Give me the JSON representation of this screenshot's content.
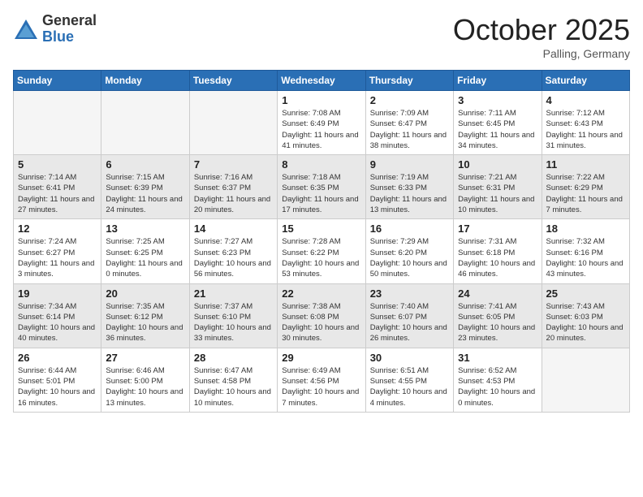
{
  "header": {
    "logo_general": "General",
    "logo_blue": "Blue",
    "month_title": "October 2025",
    "location": "Palling, Germany"
  },
  "weekdays": [
    "Sunday",
    "Monday",
    "Tuesday",
    "Wednesday",
    "Thursday",
    "Friday",
    "Saturday"
  ],
  "weeks": [
    {
      "shaded": false,
      "days": [
        {
          "num": "",
          "info": ""
        },
        {
          "num": "",
          "info": ""
        },
        {
          "num": "",
          "info": ""
        },
        {
          "num": "1",
          "info": "Sunrise: 7:08 AM\nSunset: 6:49 PM\nDaylight: 11 hours and 41 minutes."
        },
        {
          "num": "2",
          "info": "Sunrise: 7:09 AM\nSunset: 6:47 PM\nDaylight: 11 hours and 38 minutes."
        },
        {
          "num": "3",
          "info": "Sunrise: 7:11 AM\nSunset: 6:45 PM\nDaylight: 11 hours and 34 minutes."
        },
        {
          "num": "4",
          "info": "Sunrise: 7:12 AM\nSunset: 6:43 PM\nDaylight: 11 hours and 31 minutes."
        }
      ]
    },
    {
      "shaded": true,
      "days": [
        {
          "num": "5",
          "info": "Sunrise: 7:14 AM\nSunset: 6:41 PM\nDaylight: 11 hours and 27 minutes."
        },
        {
          "num": "6",
          "info": "Sunrise: 7:15 AM\nSunset: 6:39 PM\nDaylight: 11 hours and 24 minutes."
        },
        {
          "num": "7",
          "info": "Sunrise: 7:16 AM\nSunset: 6:37 PM\nDaylight: 11 hours and 20 minutes."
        },
        {
          "num": "8",
          "info": "Sunrise: 7:18 AM\nSunset: 6:35 PM\nDaylight: 11 hours and 17 minutes."
        },
        {
          "num": "9",
          "info": "Sunrise: 7:19 AM\nSunset: 6:33 PM\nDaylight: 11 hours and 13 minutes."
        },
        {
          "num": "10",
          "info": "Sunrise: 7:21 AM\nSunset: 6:31 PM\nDaylight: 11 hours and 10 minutes."
        },
        {
          "num": "11",
          "info": "Sunrise: 7:22 AM\nSunset: 6:29 PM\nDaylight: 11 hours and 7 minutes."
        }
      ]
    },
    {
      "shaded": false,
      "days": [
        {
          "num": "12",
          "info": "Sunrise: 7:24 AM\nSunset: 6:27 PM\nDaylight: 11 hours and 3 minutes."
        },
        {
          "num": "13",
          "info": "Sunrise: 7:25 AM\nSunset: 6:25 PM\nDaylight: 11 hours and 0 minutes."
        },
        {
          "num": "14",
          "info": "Sunrise: 7:27 AM\nSunset: 6:23 PM\nDaylight: 10 hours and 56 minutes."
        },
        {
          "num": "15",
          "info": "Sunrise: 7:28 AM\nSunset: 6:22 PM\nDaylight: 10 hours and 53 minutes."
        },
        {
          "num": "16",
          "info": "Sunrise: 7:29 AM\nSunset: 6:20 PM\nDaylight: 10 hours and 50 minutes."
        },
        {
          "num": "17",
          "info": "Sunrise: 7:31 AM\nSunset: 6:18 PM\nDaylight: 10 hours and 46 minutes."
        },
        {
          "num": "18",
          "info": "Sunrise: 7:32 AM\nSunset: 6:16 PM\nDaylight: 10 hours and 43 minutes."
        }
      ]
    },
    {
      "shaded": true,
      "days": [
        {
          "num": "19",
          "info": "Sunrise: 7:34 AM\nSunset: 6:14 PM\nDaylight: 10 hours and 40 minutes."
        },
        {
          "num": "20",
          "info": "Sunrise: 7:35 AM\nSunset: 6:12 PM\nDaylight: 10 hours and 36 minutes."
        },
        {
          "num": "21",
          "info": "Sunrise: 7:37 AM\nSunset: 6:10 PM\nDaylight: 10 hours and 33 minutes."
        },
        {
          "num": "22",
          "info": "Sunrise: 7:38 AM\nSunset: 6:08 PM\nDaylight: 10 hours and 30 minutes."
        },
        {
          "num": "23",
          "info": "Sunrise: 7:40 AM\nSunset: 6:07 PM\nDaylight: 10 hours and 26 minutes."
        },
        {
          "num": "24",
          "info": "Sunrise: 7:41 AM\nSunset: 6:05 PM\nDaylight: 10 hours and 23 minutes."
        },
        {
          "num": "25",
          "info": "Sunrise: 7:43 AM\nSunset: 6:03 PM\nDaylight: 10 hours and 20 minutes."
        }
      ]
    },
    {
      "shaded": false,
      "days": [
        {
          "num": "26",
          "info": "Sunrise: 6:44 AM\nSunset: 5:01 PM\nDaylight: 10 hours and 16 minutes."
        },
        {
          "num": "27",
          "info": "Sunrise: 6:46 AM\nSunset: 5:00 PM\nDaylight: 10 hours and 13 minutes."
        },
        {
          "num": "28",
          "info": "Sunrise: 6:47 AM\nSunset: 4:58 PM\nDaylight: 10 hours and 10 minutes."
        },
        {
          "num": "29",
          "info": "Sunrise: 6:49 AM\nSunset: 4:56 PM\nDaylight: 10 hours and 7 minutes."
        },
        {
          "num": "30",
          "info": "Sunrise: 6:51 AM\nSunset: 4:55 PM\nDaylight: 10 hours and 4 minutes."
        },
        {
          "num": "31",
          "info": "Sunrise: 6:52 AM\nSunset: 4:53 PM\nDaylight: 10 hours and 0 minutes."
        },
        {
          "num": "",
          "info": ""
        }
      ]
    }
  ]
}
